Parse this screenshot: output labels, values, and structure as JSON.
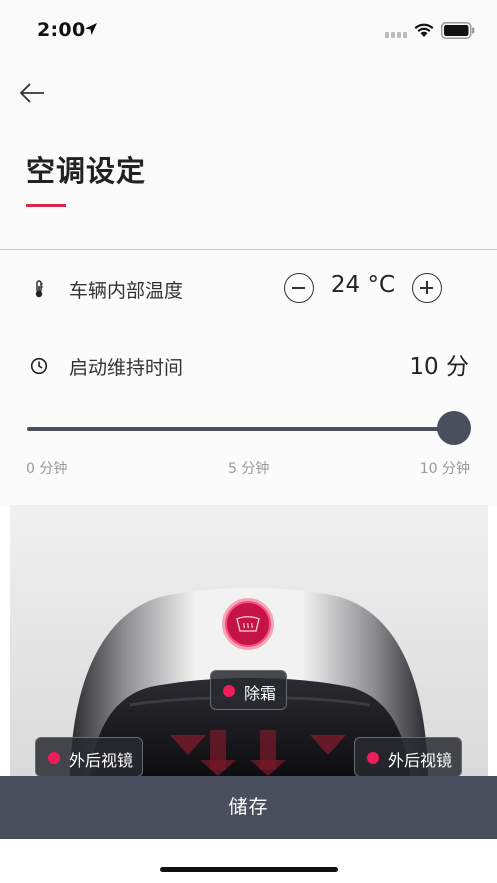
{
  "status_bar": {
    "time": "2:00",
    "location_icon": "location-arrow-icon",
    "signal_icon": "cellular-signal-icon",
    "wifi_icon": "wifi-icon",
    "battery_icon": "battery-icon"
  },
  "header": {
    "back_icon": "arrow-left-icon",
    "title": "空调设定",
    "accent_color": "#d6284a"
  },
  "temperature": {
    "icon": "thermometer-icon",
    "label": "车辆内部温度",
    "value": "24 °C",
    "decrease_icon": "minus-circle-icon",
    "increase_icon": "plus-circle-icon"
  },
  "duration": {
    "icon": "clock-icon",
    "label": "启动维持时间",
    "value": "10 分"
  },
  "slider": {
    "min_minutes": 0,
    "max_minutes": 10,
    "current_minutes": 10,
    "ticks": [
      "0 分钟",
      "5 分钟",
      "10 分钟"
    ],
    "color": "#4a4f5e"
  },
  "car_zones": {
    "defrost_icon": "windshield-defrost-icon",
    "defrost_label": "除霜",
    "left_mirror_label": "外后视镜",
    "right_mirror_label": "外后视镜",
    "active_color": "#ee1e5a"
  },
  "footer": {
    "save_label": "储存",
    "bar_color": "#4a4f5e"
  }
}
